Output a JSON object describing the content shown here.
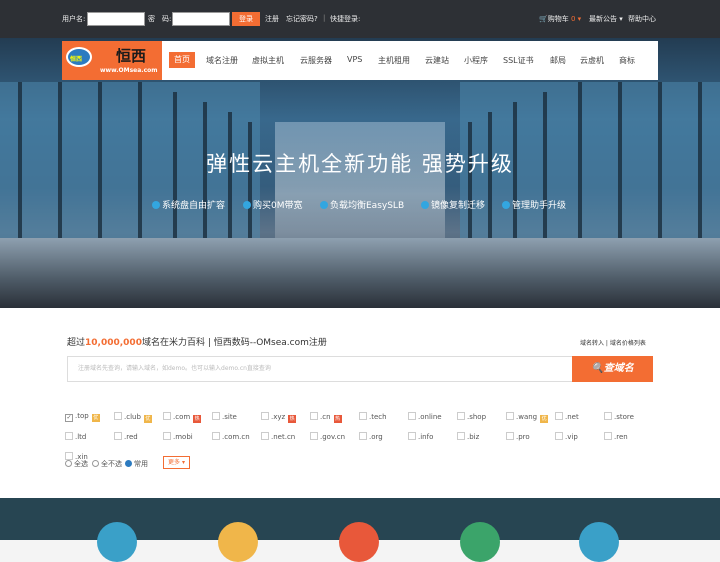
{
  "topbar": {
    "username_label": "用户名:",
    "password_label": "密　码:",
    "login": "登录",
    "register": "注册",
    "forgot": "忘记密码?",
    "quick_login": "快捷登录:",
    "cart": "购物车",
    "cart_count": "0",
    "notice": "最新公告",
    "help": "帮助中心"
  },
  "logo": {
    "name": "恒西",
    "url": "www.OMsea.com",
    "badge": "恒西"
  },
  "nav": [
    "首页",
    "域名注册",
    "虚拟主机",
    "云服务器",
    "VPS",
    "主机租用",
    "云建站",
    "小程序",
    "SSL证书",
    "邮局",
    "云虚机",
    "商标"
  ],
  "hero": {
    "title": "弹性云主机全新功能  强势升级",
    "features": [
      "系统盘自由扩容",
      "购买0M带宽",
      "负载均衡EasySLB",
      "镜像复制迁移",
      "管理助手升级"
    ]
  },
  "domain": {
    "title_prefix": "超过",
    "title_count": "10,000,000",
    "title_suffix": "域名在米力百科 | 恒西数码--OMsea.com注册",
    "links": "域名转入 | 域名价格列表",
    "placeholder": "注册域名先查询，请输入域名，如demo。也可以输入demo.cn直接查询",
    "search_btn": "查域名",
    "tlds": [
      {
        "name": ".top",
        "checked": true,
        "tag": "优",
        "tag_color": "orange"
      },
      {
        "name": ".club",
        "checked": false,
        "tag": "优",
        "tag_color": "orange"
      },
      {
        "name": ".com",
        "checked": false,
        "tag": "热",
        "tag_color": "red"
      },
      {
        "name": ".site",
        "checked": false,
        "tag": "",
        "tag_color": ""
      },
      {
        "name": ".xyz",
        "checked": false,
        "tag": "热",
        "tag_color": "red"
      },
      {
        "name": ".cn",
        "checked": false,
        "tag": "热",
        "tag_color": "red"
      },
      {
        "name": ".tech",
        "checked": false,
        "tag": "",
        "tag_color": ""
      },
      {
        "name": ".online",
        "checked": false,
        "tag": "",
        "tag_color": ""
      },
      {
        "name": ".shop",
        "checked": false,
        "tag": "",
        "tag_color": ""
      },
      {
        "name": ".wang",
        "checked": false,
        "tag": "优",
        "tag_color": "orange"
      },
      {
        "name": ".net",
        "checked": false,
        "tag": "",
        "tag_color": ""
      },
      {
        "name": ".store",
        "checked": false,
        "tag": "",
        "tag_color": ""
      },
      {
        "name": ".ltd",
        "checked": false,
        "tag": "",
        "tag_color": ""
      },
      {
        "name": ".red",
        "checked": false,
        "tag": "",
        "tag_color": ""
      },
      {
        "name": ".mobi",
        "checked": false,
        "tag": "",
        "tag_color": ""
      },
      {
        "name": ".com.cn",
        "checked": false,
        "tag": "",
        "tag_color": ""
      },
      {
        "name": ".net.cn",
        "checked": false,
        "tag": "",
        "tag_color": ""
      },
      {
        "name": ".gov.cn",
        "checked": false,
        "tag": "",
        "tag_color": ""
      },
      {
        "name": ".org",
        "checked": false,
        "tag": "",
        "tag_color": ""
      },
      {
        "name": ".info",
        "checked": false,
        "tag": "",
        "tag_color": ""
      },
      {
        "name": ".biz",
        "checked": false,
        "tag": "",
        "tag_color": ""
      },
      {
        "name": ".pro",
        "checked": false,
        "tag": "",
        "tag_color": ""
      },
      {
        "name": ".vip",
        "checked": false,
        "tag": "",
        "tag_color": ""
      },
      {
        "name": ".ren",
        "checked": false,
        "tag": "",
        "tag_color": ""
      },
      {
        "name": ".xin",
        "checked": false,
        "tag": "",
        "tag_color": ""
      }
    ],
    "radios": [
      {
        "label": "全选",
        "checked": false
      },
      {
        "label": "全不选",
        "checked": false
      },
      {
        "label": "常用",
        "checked": true
      }
    ],
    "more": "更多"
  },
  "colors": {
    "accent": "#f36d33",
    "topbar": "#2d3035",
    "footer": "#274552",
    "icon_circles": [
      "#3aa0c8",
      "#f0b64a",
      "#e8583a",
      "#3ba46a",
      "#3aa0c8"
    ]
  }
}
